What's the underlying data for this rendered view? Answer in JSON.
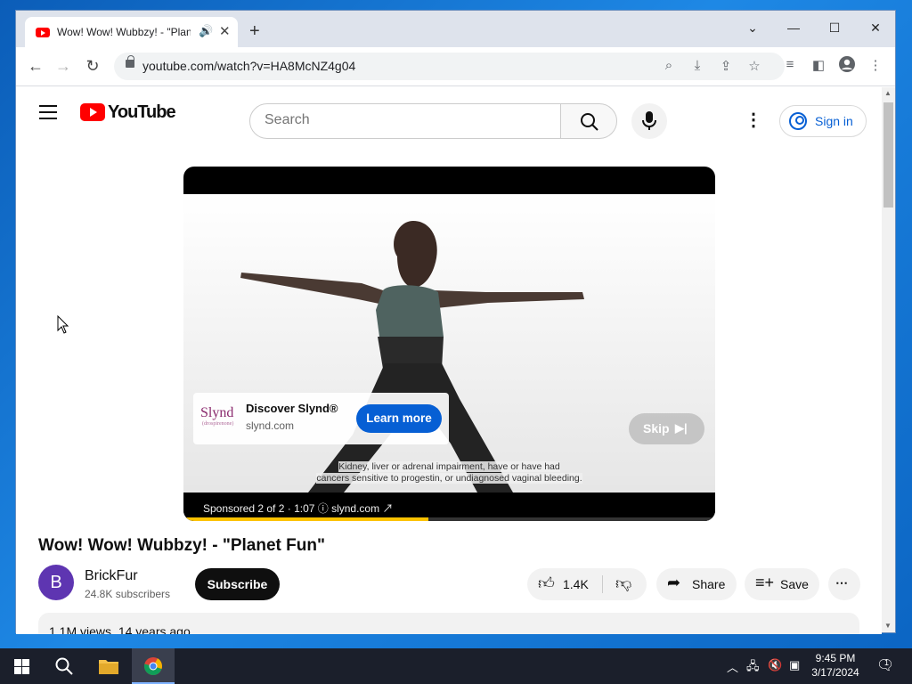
{
  "browser": {
    "tab_title": "Wow! Wow! Wubbzy! - \"Plan",
    "url": "youtube.com/watch?v=HA8McNZ4g04"
  },
  "youtube": {
    "logo_text": "YouTube",
    "search_placeholder": "Search",
    "sign_in_label": "Sign in"
  },
  "ad": {
    "brand_logo": "Slynd",
    "brand_logo_sub": "(drospirenone)",
    "title": "Discover Slynd®",
    "domain": "slynd.com",
    "cta_label": "Learn more",
    "skip_label": "Skip",
    "disclaimer_line1": "Kidney, liver or adrenal impairment, have or have had",
    "disclaimer_line2": "cancers sensitive to progestin, or undiagnosed vaginal bleeding.",
    "sponsored_text": "Sponsored 2 of 2 · 1:07  ⓘ   slynd.com ↗",
    "progress_fraction": 0.46
  },
  "video": {
    "title": "Wow! Wow! Wubbzy! - \"Planet Fun\"",
    "channel_initial": "B",
    "channel_name": "BrickFur",
    "subscribers": "24.8K subscribers",
    "subscribe_label": "Subscribe",
    "likes": "1.4K",
    "share_label": "Share",
    "save_label": "Save",
    "views": "1.1M views",
    "age": "14 years ago"
  },
  "taskbar": {
    "time": "9:45 PM",
    "date": "3/17/2024",
    "notification_count": "1"
  },
  "colors": {
    "youtube_red": "#ff0000",
    "link_blue": "#065fd4",
    "ad_progress": "#fcc200",
    "avatar": "#5e35b1"
  }
}
